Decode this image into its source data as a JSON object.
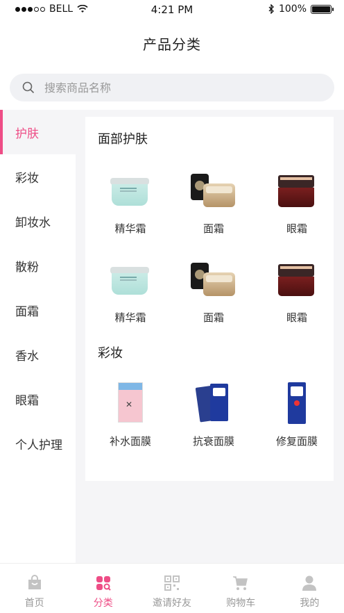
{
  "status_bar": {
    "carrier": "BELL",
    "time": "4:21 PM",
    "battery": "100%"
  },
  "header": {
    "title": "产品分类"
  },
  "search": {
    "placeholder": "搜索商品名称"
  },
  "sidebar": {
    "items": [
      {
        "label": "护肤",
        "active": true
      },
      {
        "label": "彩妆"
      },
      {
        "label": "卸妆水"
      },
      {
        "label": "散粉"
      },
      {
        "label": "面霜"
      },
      {
        "label": "香水"
      },
      {
        "label": "眼霜"
      },
      {
        "label": "个人护理"
      }
    ]
  },
  "sections": [
    {
      "title": "面部护肤",
      "items": [
        {
          "label": "精华霜",
          "image": "white-cream-jar"
        },
        {
          "label": "面霜",
          "image": "gold-cream-jar"
        },
        {
          "label": "眼霜",
          "image": "red-cream-jar"
        },
        {
          "label": "精华霜",
          "image": "white-cream-jar"
        },
        {
          "label": "面霜",
          "image": "gold-cream-jar"
        },
        {
          "label": "眼霜",
          "image": "red-cream-jar"
        }
      ]
    },
    {
      "title": "彩妆",
      "items": [
        {
          "label": "补水面膜",
          "image": "pink-mask-pack"
        },
        {
          "label": "抗衰面膜",
          "image": "blue-mask-pack"
        },
        {
          "label": "修复面膜",
          "image": "blue-mask-single"
        }
      ]
    }
  ],
  "tabbar": {
    "tabs": [
      {
        "label": "首页",
        "icon": "bag-icon"
      },
      {
        "label": "分类",
        "icon": "category-icon",
        "active": true
      },
      {
        "label": "邀请好友",
        "icon": "qr-code-icon"
      },
      {
        "label": "购物车",
        "icon": "cart-icon"
      },
      {
        "label": "我的",
        "icon": "user-icon"
      }
    ]
  },
  "colors": {
    "accent": "#ee4d86",
    "inactive": "#999999",
    "background": "#f5f5f7"
  }
}
